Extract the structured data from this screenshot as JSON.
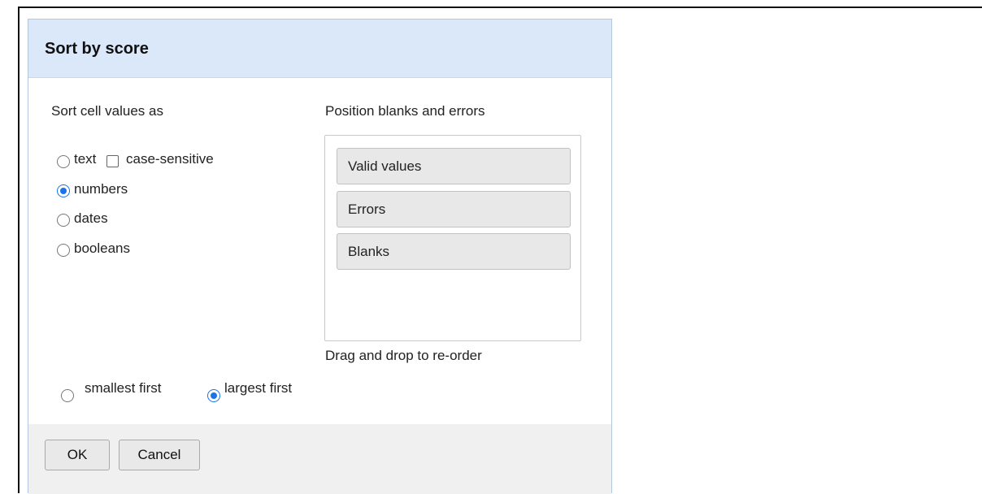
{
  "dialog": {
    "title": "Sort by score"
  },
  "sort_as": {
    "label": "Sort cell values as",
    "options": [
      {
        "label": "text",
        "checked": false
      },
      {
        "label": "numbers",
        "checked": true
      },
      {
        "label": "dates",
        "checked": false
      },
      {
        "label": "booleans",
        "checked": false
      }
    ],
    "case_sensitive": {
      "label": "case-sensitive",
      "checked": false
    }
  },
  "position": {
    "label": "Position blanks and errors",
    "items": [
      "Valid values",
      "Errors",
      "Blanks"
    ],
    "hint": "Drag and drop to re-order"
  },
  "direction": {
    "options": [
      {
        "label": "smallest first",
        "checked": false
      },
      {
        "label": "largest first",
        "checked": true
      }
    ]
  },
  "buttons": {
    "ok": "OK",
    "cancel": "Cancel"
  },
  "colors": {
    "header_bg": "#dbe8f9",
    "accent": "#1a73e8",
    "footer_bg": "#f0f0f0"
  }
}
